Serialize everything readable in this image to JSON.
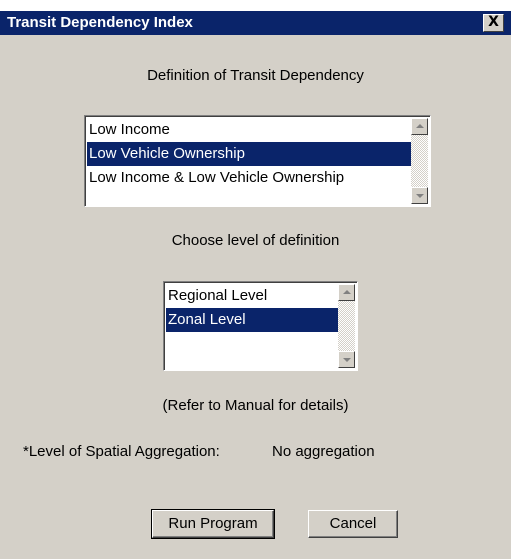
{
  "window": {
    "title": "Transit Dependency Index",
    "close_symbol": "X"
  },
  "definition": {
    "heading": "Definition of Transit Dependency",
    "items": [
      {
        "label": "Low Income",
        "selected": false
      },
      {
        "label": "Low Vehicle Ownership",
        "selected": true
      },
      {
        "label": "Low Income & Low Vehicle Ownership",
        "selected": false
      }
    ]
  },
  "level": {
    "heading": "Choose level of definition",
    "items": [
      {
        "label": "Regional Level",
        "selected": false
      },
      {
        "label": "Zonal Level",
        "selected": true
      }
    ]
  },
  "note": "(Refer to Manual for details)",
  "aggregation": {
    "label": "*Level of Spatial Aggregation:",
    "value": "No aggregation"
  },
  "buttons": {
    "run": "Run Program",
    "cancel": "Cancel"
  },
  "colors": {
    "titlebar": "#0a246a",
    "selection": "#0a246a",
    "face": "#d4d0c8"
  },
  "icons": {
    "close": "close-icon",
    "scroll_up": "arrow-up-icon",
    "scroll_down": "arrow-down-icon"
  }
}
